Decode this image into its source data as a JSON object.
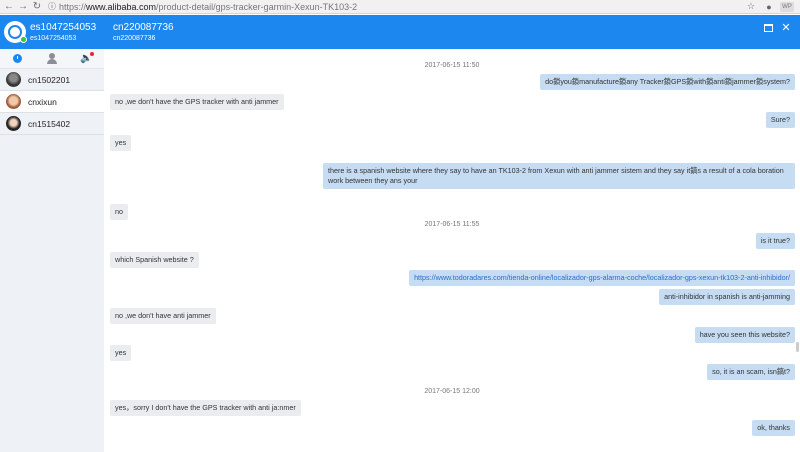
{
  "browser": {
    "url_prefix": "https://",
    "url_host": "www.alibaba.com",
    "url_path": "/product-detail/gps-tracker-garmin-Xexun-TK103-2",
    "ext_label": "WP"
  },
  "user": {
    "name": "es1047254053",
    "id": "es1047254053"
  },
  "contacts": [
    {
      "name": "cn1502201"
    },
    {
      "name": "cnxixun"
    },
    {
      "name": "cn1515402"
    }
  ],
  "chat": {
    "title": "cn220087736",
    "subtitle": "cn220087736"
  },
  "messages": [
    {
      "type": "time",
      "text": "2017-06-15 11:50"
    },
    {
      "type": "out",
      "text": "do鎖you鎖manufacture鎖any Tracker鎖GPS鎖with鎖anti鎖jammer鎖system?"
    },
    {
      "type": "in",
      "text": "no ,we don't have the GPS tracker with anti jammer"
    },
    {
      "type": "out",
      "text": "Sure?"
    },
    {
      "type": "in",
      "text": "yes"
    },
    {
      "type": "out",
      "text": "there is a spanish website where they say to have an TK103-2 from Xexun with anti jammer sistem and they say it鎬s a result of a cola boration work between they ans your"
    },
    {
      "type": "in",
      "text": "no"
    },
    {
      "type": "time",
      "text": "2017-06-15 11:55"
    },
    {
      "type": "out",
      "text": "is it true?"
    },
    {
      "type": "in",
      "text": "which Spanish website ?"
    },
    {
      "type": "out",
      "text": "https://www.todoradares.com/tienda-online/localizador-gps-alarma-coche/localizador-gps-xexun-tk103-2-anti-inhibidor/"
    },
    {
      "type": "out",
      "text": "anti-inhibidor in spanish is anti-jamming"
    },
    {
      "type": "in",
      "text": "no ,we don't have anti jammer"
    },
    {
      "type": "out",
      "text": "have you seen this website?"
    },
    {
      "type": "in",
      "text": "yes"
    },
    {
      "type": "out",
      "text": "so, it is an scam, isn鎬t?"
    },
    {
      "type": "time",
      "text": "2017-06-15 12:00"
    },
    {
      "type": "in",
      "text": "yes，sorry I don't have the GPS tracker with anti ja:nmer"
    },
    {
      "type": "out",
      "text": "ok, thanks"
    }
  ]
}
